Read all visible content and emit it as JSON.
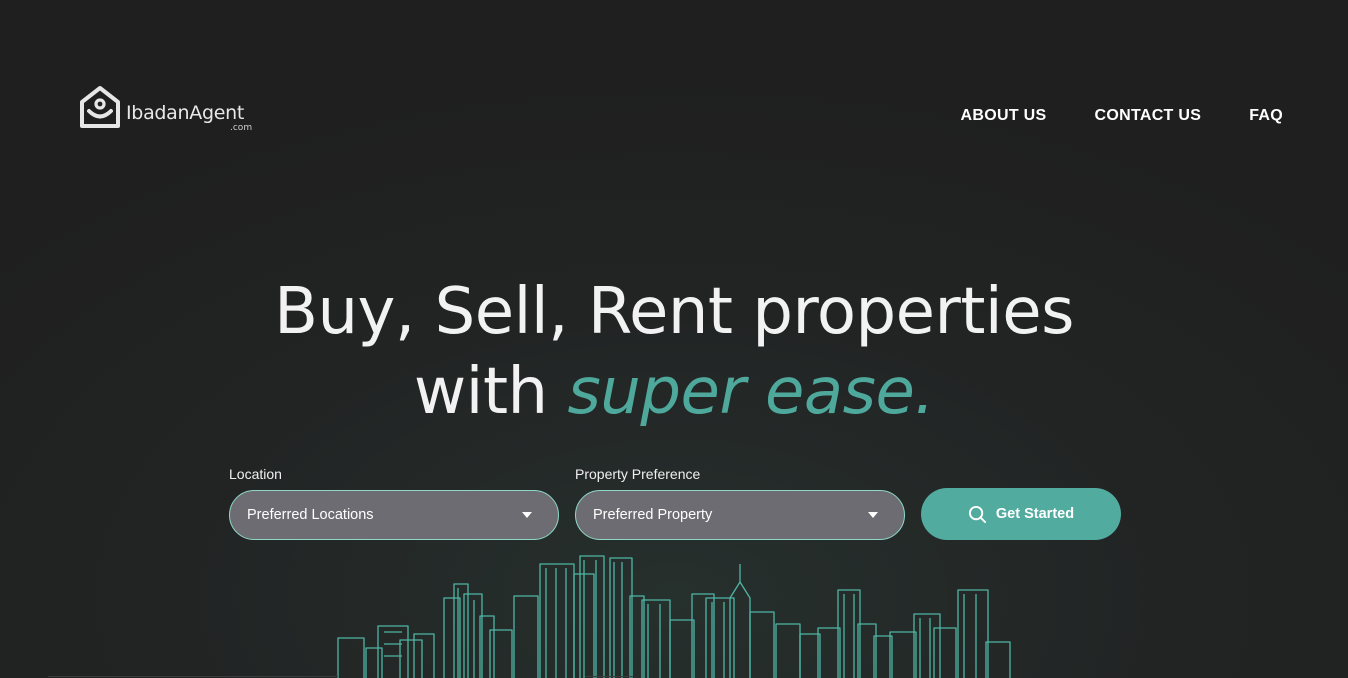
{
  "brand": {
    "name": "IbadanAgent",
    "tld": ".com"
  },
  "nav": {
    "items": [
      {
        "label": "ABOUT US"
      },
      {
        "label": "CONTACT US"
      },
      {
        "label": "FAQ"
      }
    ]
  },
  "hero": {
    "line1": "Buy, Sell, Rent properties",
    "line2_prefix": "with ",
    "line2_accent": "super ease."
  },
  "search": {
    "location": {
      "label": "Location",
      "value": "Preferred Locations"
    },
    "property": {
      "label": "Property Preference",
      "value": "Preferred Property"
    },
    "submit_label": "Get Started"
  },
  "colors": {
    "background": "#222222",
    "accent": "#52ab9f",
    "select_fill": "#6c6c72",
    "select_border": "#8fd8c8"
  },
  "icons": [
    "home-person-logo-icon",
    "chevron-down-icon",
    "search-icon",
    "city-skyline-illustration"
  ]
}
